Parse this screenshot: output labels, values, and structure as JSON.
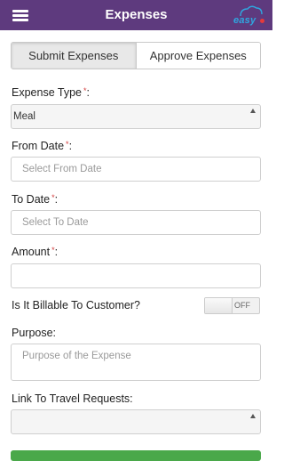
{
  "header": {
    "title": "Expenses",
    "logo_text": "easy",
    "bar_color": "#5e3a7e"
  },
  "tabs": [
    {
      "label": "Submit Expenses",
      "active": true
    },
    {
      "label": "Approve Expenses",
      "active": false
    }
  ],
  "form": {
    "required_mark": "*",
    "expense_type": {
      "label": "Expense Type",
      "value": "Meal"
    },
    "from_date": {
      "label": "From Date",
      "placeholder": "Select From Date"
    },
    "to_date": {
      "label": "To Date",
      "placeholder": "Select To Date"
    },
    "amount": {
      "label": "Amount",
      "value": ""
    },
    "billable": {
      "label": "Is It Billable To Customer?",
      "state_text": "OFF"
    },
    "purpose": {
      "label": "Purpose:",
      "placeholder": "Purpose of the Expense"
    },
    "travel": {
      "label": "Link To Travel Requests:",
      "value": ""
    }
  },
  "colors": {
    "required": "#d23c3c",
    "submit_button": "#4aa84a"
  }
}
